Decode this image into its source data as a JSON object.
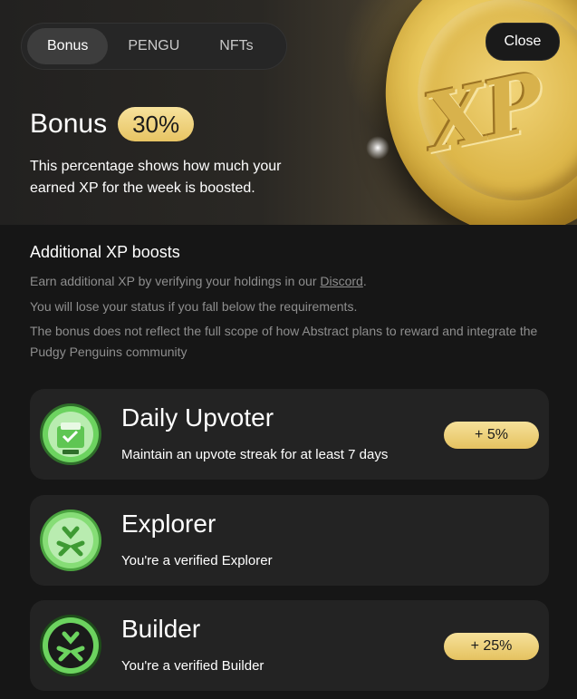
{
  "tabs": [
    {
      "label": "Bonus",
      "active": true
    },
    {
      "label": "PENGU",
      "active": false
    },
    {
      "label": "NFTs",
      "active": false
    }
  ],
  "close_label": "Close",
  "hero": {
    "title": "Bonus",
    "percent": "30%",
    "description": "This percentage shows how much your earned XP for the week is boosted.",
    "coin_text": "XP"
  },
  "additional": {
    "title": "Additional XP boosts",
    "line1_prefix": "Earn additional XP by verifying your holdings in our ",
    "line1_link": "Discord",
    "line1_suffix": ".",
    "line2": "You will lose your status if you fall below the requirements.",
    "line3": "The bonus does not reflect the full scope of how Abstract plans to reward and integrate the Pudgy Penguins community"
  },
  "boosts": [
    {
      "title": "Daily Upvoter",
      "description": "Maintain an upvote streak for at least 7 days",
      "pill": "+ 5%",
      "icon": "vote-badge-icon"
    },
    {
      "title": "Explorer",
      "description": "You're a verified Explorer",
      "pill": "",
      "icon": "explorer-badge-icon"
    },
    {
      "title": "Builder",
      "description": "You're a verified Builder",
      "pill": "+ 25%",
      "icon": "builder-badge-icon"
    }
  ],
  "colors": {
    "gold": "#e7c463",
    "badge_green": "#6cd35f",
    "card_bg": "#232323"
  }
}
